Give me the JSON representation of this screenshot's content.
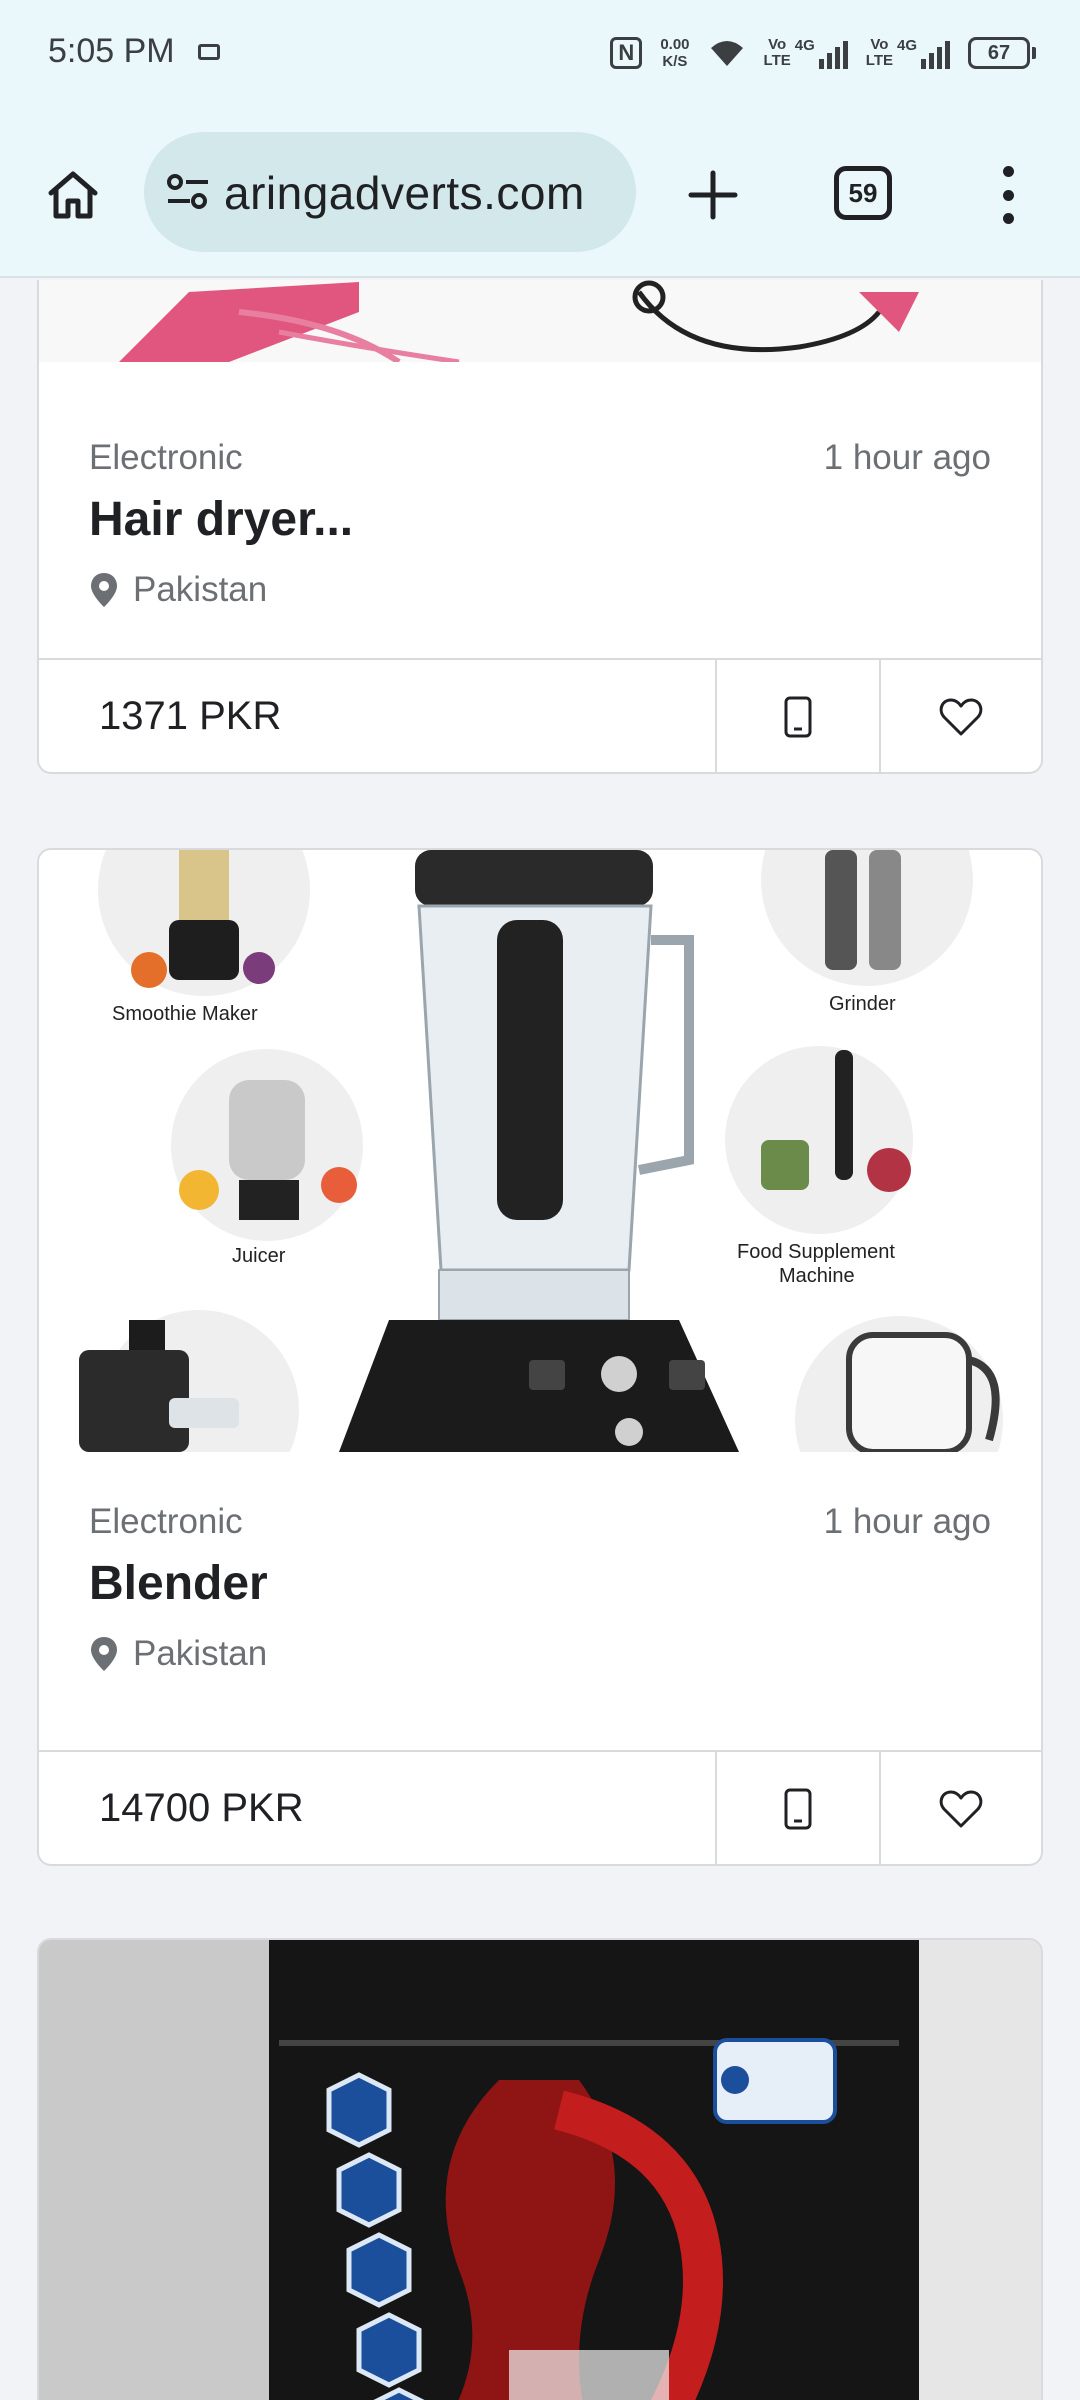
{
  "status_bar": {
    "time": "5:05 PM",
    "net_speed_value": "0.00",
    "net_speed_unit": "K/S",
    "volte_1": "Vo\nLTE",
    "sig_1": "4G",
    "volte_2": "Vo\nLTE",
    "sig_2": "4G",
    "battery": "67"
  },
  "browser": {
    "url": "aringadverts.com",
    "tab_count": "59"
  },
  "listings": [
    {
      "category": "Electronic",
      "time": "1 hour ago",
      "title": "Hair dryer...",
      "location": "Pakistan",
      "price": "1371 PKR"
    },
    {
      "category": "Electronic",
      "time": "1 hour ago",
      "title": "Blender",
      "location": "Pakistan",
      "price": "14700 PKR",
      "image_labels": [
        "Smoothie Maker",
        "Grinder",
        "Juicer",
        "Food Supplement",
        "Machine"
      ]
    }
  ]
}
